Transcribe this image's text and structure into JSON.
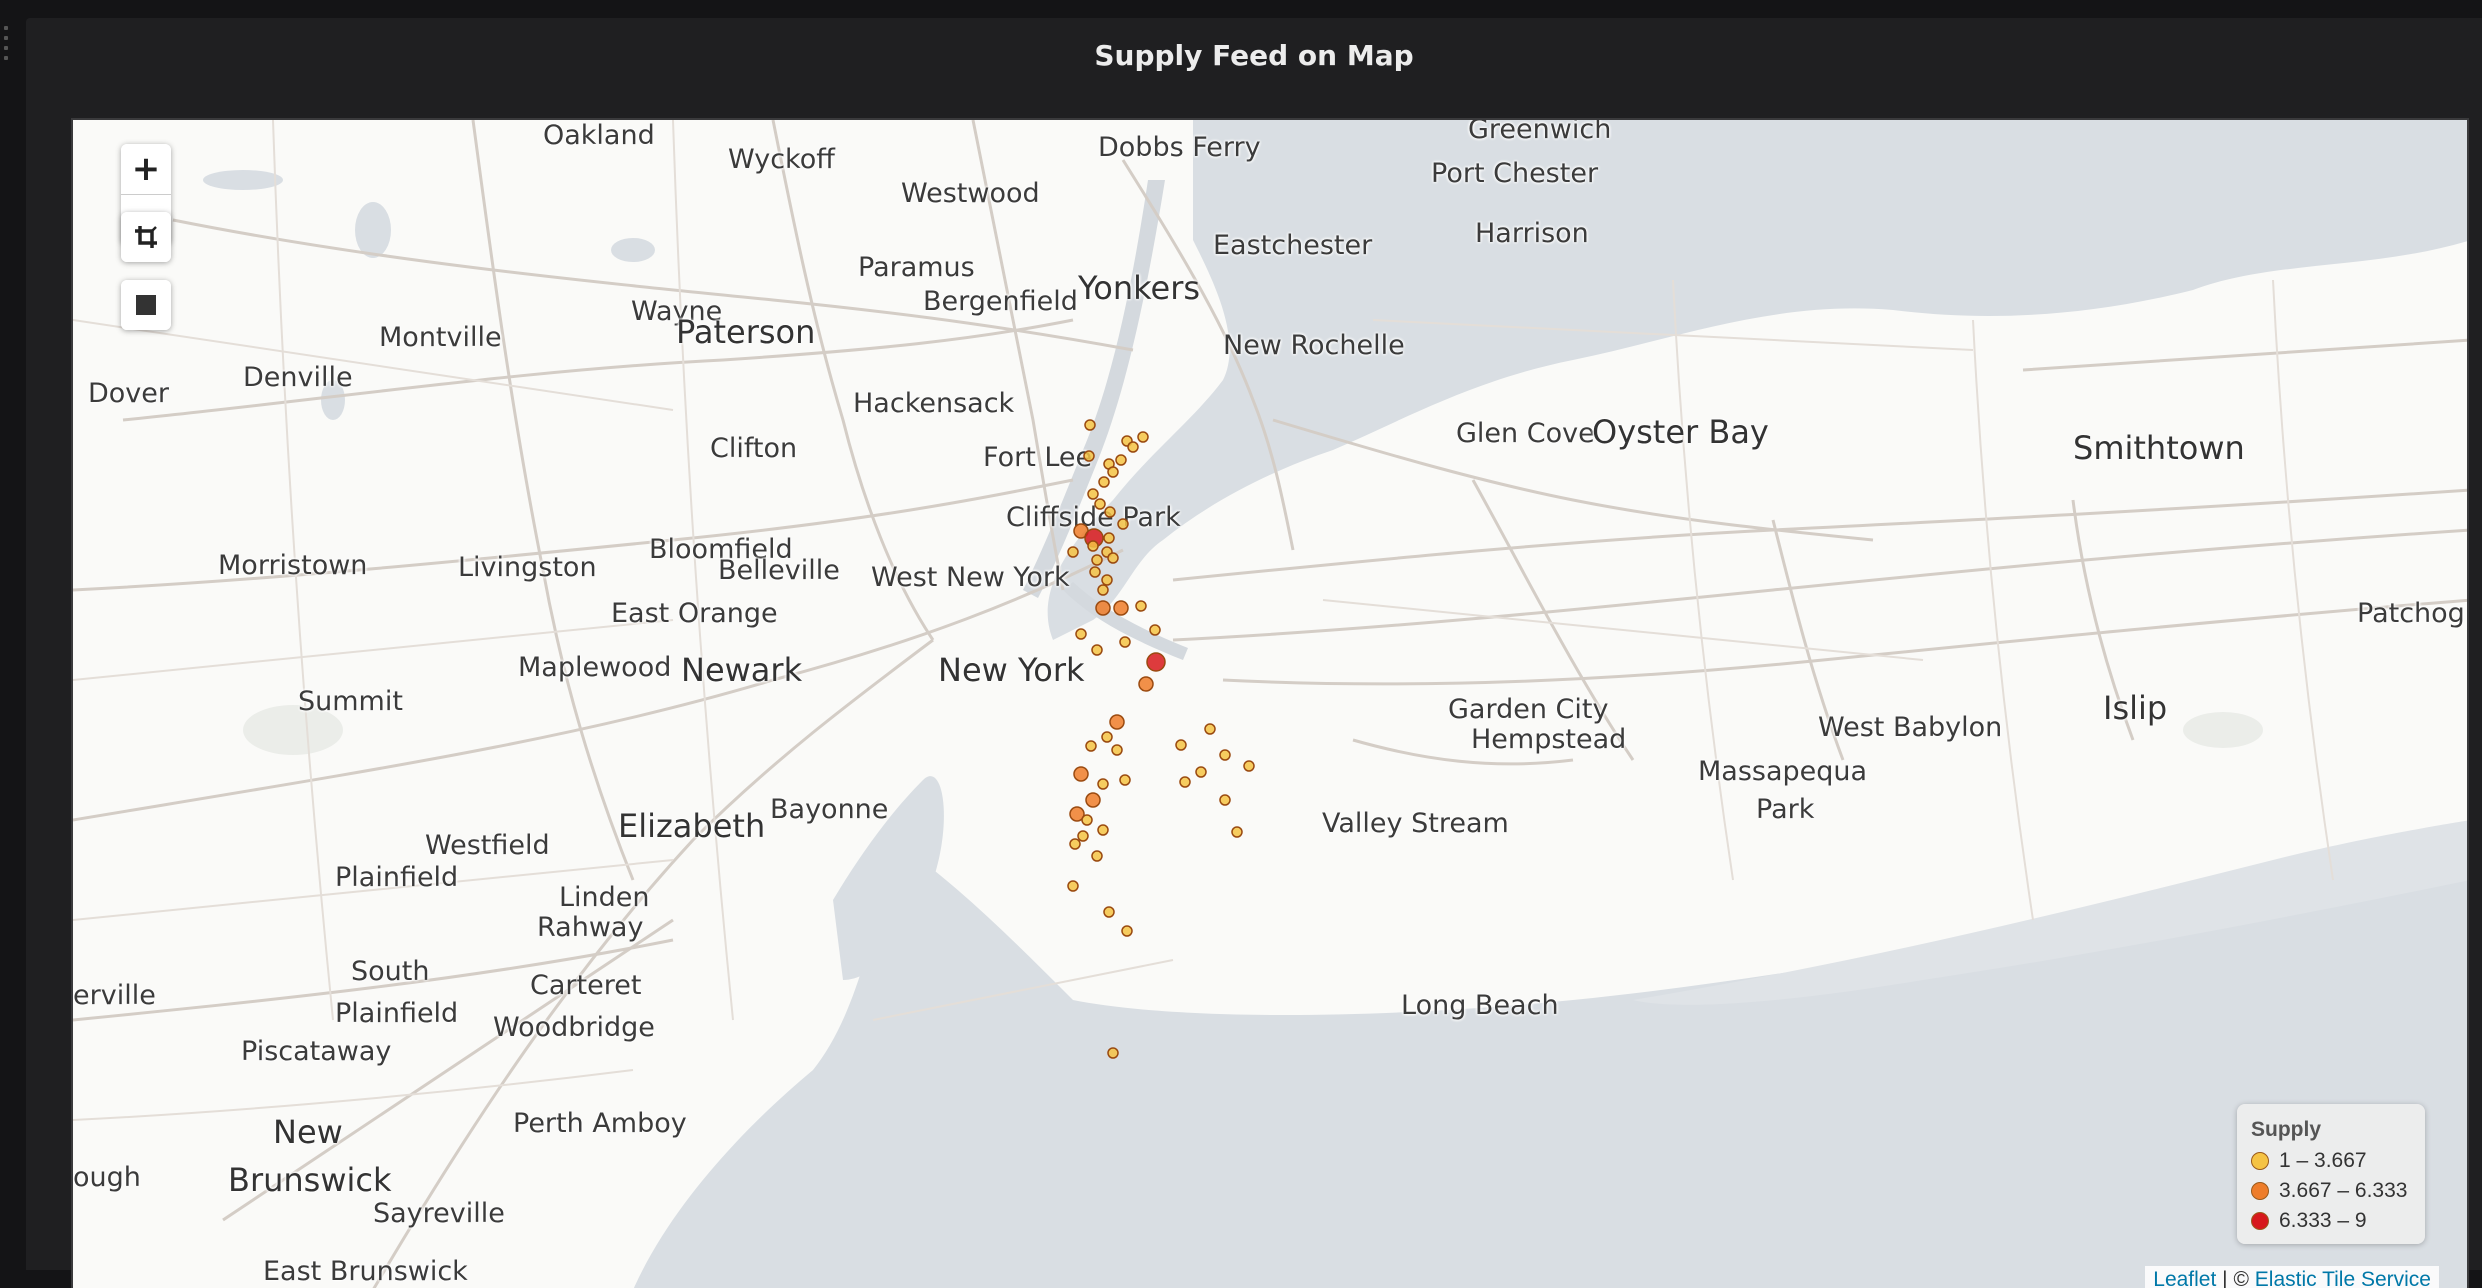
{
  "panel": {
    "title": "Supply Feed on Map"
  },
  "controls": {
    "zoom_in": "+",
    "zoom_out": "−",
    "crop_icon": "crop-icon",
    "draw_rect_icon": "square-icon"
  },
  "map_labels": [
    {
      "text": "Oakland",
      "big": false
    },
    {
      "text": "Wyckoff",
      "big": false
    },
    {
      "text": "Dobbs Ferry",
      "big": false
    },
    {
      "text": "Greenwich",
      "big": false
    },
    {
      "text": "Westwood",
      "big": false
    },
    {
      "text": "Port Chester",
      "big": false
    },
    {
      "text": "Harrison",
      "big": false
    },
    {
      "text": "Eastchester",
      "big": false
    },
    {
      "text": "Wayne",
      "big": false
    },
    {
      "text": "Paramus",
      "big": false
    },
    {
      "text": "Bergenfield",
      "big": false
    },
    {
      "text": "Yonkers",
      "big": true
    },
    {
      "text": "Montville",
      "big": false
    },
    {
      "text": "Paterson",
      "big": true
    },
    {
      "text": "New Rochelle",
      "big": false
    },
    {
      "text": "Denville",
      "big": false
    },
    {
      "text": "Dover",
      "big": false
    },
    {
      "text": "Hackensack",
      "big": false
    },
    {
      "text": "Glen Cove",
      "big": false
    },
    {
      "text": "Oyster Bay",
      "big": true
    },
    {
      "text": "Smithtown",
      "big": true
    },
    {
      "text": "Clifton",
      "big": false
    },
    {
      "text": "Fort Lee",
      "big": false
    },
    {
      "text": "Cliffside Park",
      "big": false
    },
    {
      "text": "Bloomfield",
      "big": false
    },
    {
      "text": "Morristown",
      "big": false
    },
    {
      "text": "Livingston",
      "big": false
    },
    {
      "text": "Belleville",
      "big": false
    },
    {
      "text": "West New York",
      "big": false
    },
    {
      "text": "East Orange",
      "big": false
    },
    {
      "text": "Patchog",
      "big": false
    },
    {
      "text": "Newark",
      "big": true
    },
    {
      "text": "Maplewood",
      "big": false
    },
    {
      "text": "New York",
      "big": true
    },
    {
      "text": "Summit",
      "big": false
    },
    {
      "text": "Garden City",
      "big": false
    },
    {
      "text": "Islip",
      "big": true
    },
    {
      "text": "West Babylon",
      "big": false
    },
    {
      "text": "Hempstead",
      "big": false
    },
    {
      "text": "Massapequa",
      "big": false
    },
    {
      "text": "Park",
      "big": false
    },
    {
      "text": "Bayonne",
      "big": false
    },
    {
      "text": "Elizabeth",
      "big": true
    },
    {
      "text": "Westfield",
      "big": false
    },
    {
      "text": "Valley Stream",
      "big": false
    },
    {
      "text": "Plainfield",
      "big": false
    },
    {
      "text": "Linden",
      "big": false
    },
    {
      "text": "Rahway",
      "big": false
    },
    {
      "text": "South",
      "big": false
    },
    {
      "text": "Carteret",
      "big": false
    },
    {
      "text": "Long Beach",
      "big": false
    },
    {
      "text": "erville",
      "big": false
    },
    {
      "text": "Plainfield",
      "big": false
    },
    {
      "text": "Woodbridge",
      "big": false
    },
    {
      "text": "Piscataway",
      "big": false
    },
    {
      "text": "Perth Amboy",
      "big": false
    },
    {
      "text": "New",
      "big": true
    },
    {
      "text": "ough",
      "big": false
    },
    {
      "text": "Brunswick",
      "big": true
    },
    {
      "text": "Sayreville",
      "big": false
    },
    {
      "text": "East Brunswick",
      "big": false
    }
  ],
  "supply_points": [
    {
      "supply": 2
    },
    {
      "supply": 2
    },
    {
      "supply": 2
    },
    {
      "supply": 2
    },
    {
      "supply": 2
    },
    {
      "supply": 2
    },
    {
      "supply": 2
    },
    {
      "supply": 2
    },
    {
      "supply": 2
    },
    {
      "supply": 2
    },
    {
      "supply": 2
    },
    {
      "supply": 2
    },
    {
      "supply": 2
    },
    {
      "supply": 5
    },
    {
      "supply": 8
    },
    {
      "supply": 2
    },
    {
      "supply": 2
    },
    {
      "supply": 2
    },
    {
      "supply": 2
    },
    {
      "supply": 2
    },
    {
      "supply": 2
    },
    {
      "supply": 2
    },
    {
      "supply": 2
    },
    {
      "supply": 2
    },
    {
      "supply": 5
    },
    {
      "supply": 5
    },
    {
      "supply": 2
    },
    {
      "supply": 2
    },
    {
      "supply": 2
    },
    {
      "supply": 2
    },
    {
      "supply": 2
    },
    {
      "supply": 8
    },
    {
      "supply": 5
    },
    {
      "supply": 5
    },
    {
      "supply": 2
    },
    {
      "supply": 2
    },
    {
      "supply": 2
    },
    {
      "supply": 2
    },
    {
      "supply": 2
    },
    {
      "supply": 5
    },
    {
      "supply": 5
    },
    {
      "supply": 5
    },
    {
      "supply": 2
    },
    {
      "supply": 2
    },
    {
      "supply": 2
    },
    {
      "supply": 2
    },
    {
      "supply": 2
    },
    {
      "supply": 2
    },
    {
      "supply": 2
    },
    {
      "supply": 2
    },
    {
      "supply": 2
    },
    {
      "supply": 2
    },
    {
      "supply": 2
    },
    {
      "supply": 2
    },
    {
      "supply": 2
    },
    {
      "supply": 2
    },
    {
      "supply": 2
    },
    {
      "supply": 2
    },
    {
      "supply": 2
    }
  ],
  "legend": {
    "title": "Supply",
    "items": [
      {
        "label": "1 – 3.667",
        "color": "#f5c344"
      },
      {
        "label": "3.667 – 6.333",
        "color": "#ee7d2a"
      },
      {
        "label": "6.333 – 9",
        "color": "#d7191c"
      }
    ]
  },
  "attribution": {
    "leaflet": "Leaflet",
    "sep": " | © ",
    "service": "Elastic Tile Service"
  }
}
